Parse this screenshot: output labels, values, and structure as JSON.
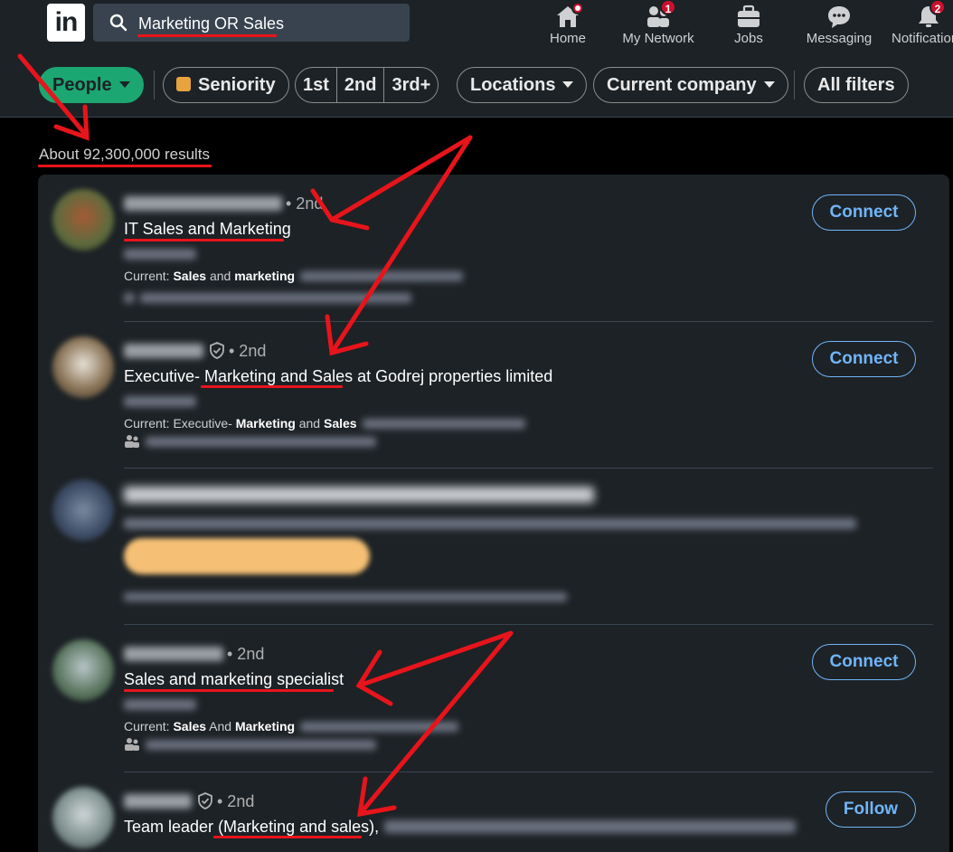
{
  "search": {
    "query": "Marketing OR Sales"
  },
  "nav": [
    {
      "label": "Home",
      "icon": "home-icon"
    },
    {
      "label": "My Network",
      "icon": "network-icon",
      "badge": "1"
    },
    {
      "label": "Jobs",
      "icon": "briefcase-icon"
    },
    {
      "label": "Messaging",
      "icon": "messaging-icon"
    },
    {
      "label": "Notifications",
      "icon": "bell-icon",
      "badge": "2"
    }
  ],
  "filters": {
    "people": "People",
    "seniority": "Seniority",
    "connections": [
      "1st",
      "2nd",
      "3rd+"
    ],
    "locations": "Locations",
    "current_company": "Current company",
    "all_filters": "All filters"
  },
  "results_count": "About 92,300,000 results",
  "results": [
    {
      "degree": "• 2nd",
      "headline": "IT Sales and Marketing",
      "current_prefix": "Current: ",
      "current_parts": [
        "Sales",
        " and ",
        "marketing"
      ],
      "action": "Connect"
    },
    {
      "degree": "• 2nd",
      "headline_prefix": "Executive- ",
      "headline_highlight": "Marketing and Sales",
      "headline_suffix": " at Godrej properties limited",
      "current_prefix": "Current: Executive- ",
      "current_parts": [
        "Marketing",
        " and ",
        "Sales"
      ],
      "action": "Connect"
    },
    {
      "degree": "• 2nd",
      "headline": "Sales and marketing specialist",
      "current_prefix": "Current: ",
      "current_parts": [
        "Sales",
        " And ",
        "Marketing"
      ],
      "action": "Connect"
    },
    {
      "degree": "• 2nd",
      "headline_prefix": "Team leader ",
      "headline_highlight": "(Marketing and sales),",
      "action": "Follow"
    }
  ],
  "colors": {
    "accent_green": "#1ba672",
    "link_blue": "#70b5f9",
    "annotation_red": "#e8141b",
    "badge_red": "#cb112d"
  }
}
